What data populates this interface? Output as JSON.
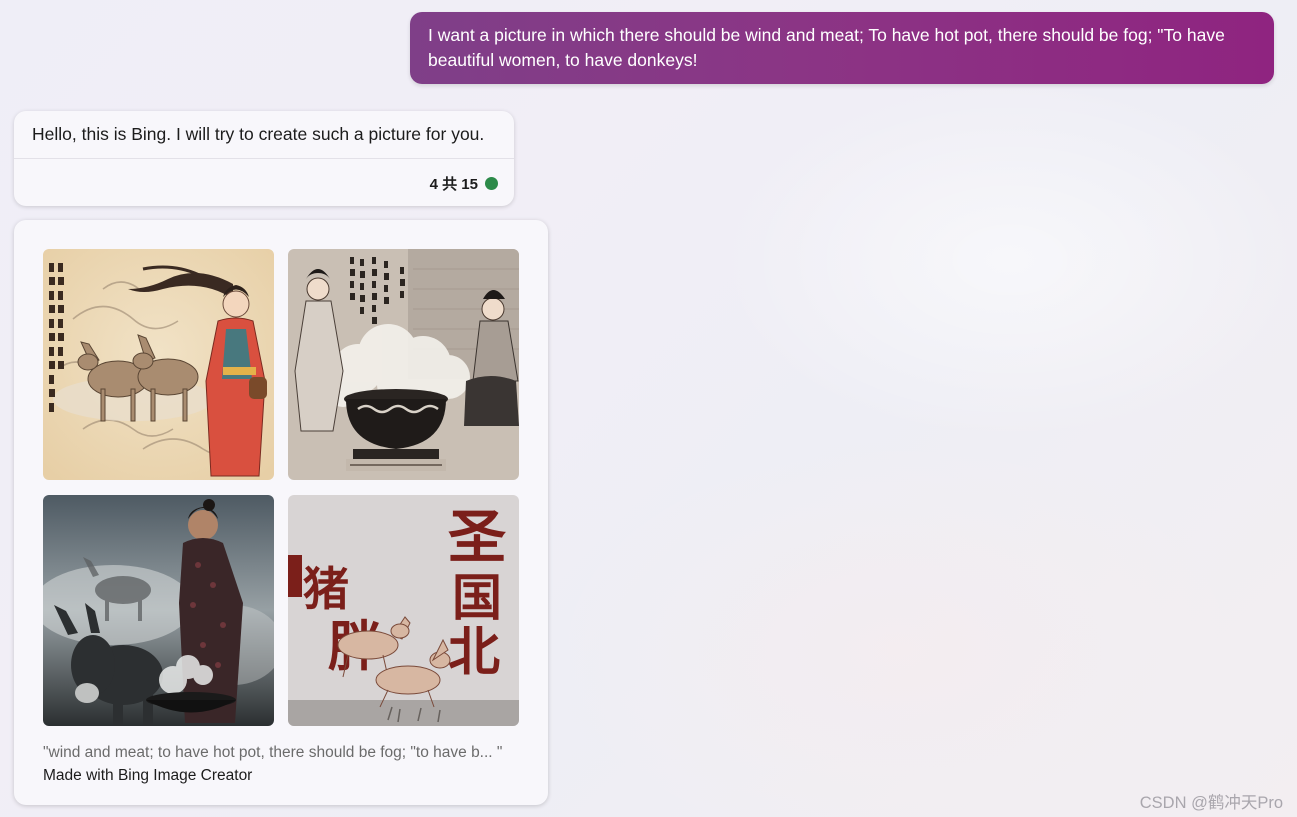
{
  "conversation": {
    "user_message": "I want a picture in which there should be wind and meat; To have hot pot, there should be fog; \"To have beautiful women, to have donkeys!",
    "bot_message": "Hello, this is Bing. I will try to create such a picture for you.",
    "turn_counter": "4 共 15",
    "status_color": "#2c8a49"
  },
  "image_card": {
    "images": [
      {
        "name": "woman-with-donkeys-in-wind"
      },
      {
        "name": "women-with-hot-pot-cauldron"
      },
      {
        "name": "woman-cooking-with-donkey"
      },
      {
        "name": "calligraphy-with-animals"
      }
    ],
    "calligraphy_chars": [
      "圣",
      "国",
      "北",
      "猪",
      "胖"
    ],
    "prompt_caption": "\"wind and meat; to have hot pot, there should be fog; \"to have b... \"",
    "credit": "Made with Bing Image Creator"
  },
  "watermark": "CSDN @鹤冲天Pro",
  "colors": {
    "user_bubble_start": "#7f3f88",
    "user_bubble_end": "#8f2480",
    "card_bg": "#f8f7fb"
  }
}
